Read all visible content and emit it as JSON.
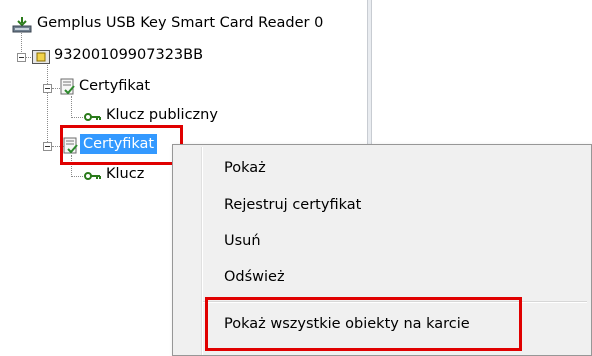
{
  "tree": {
    "reader_label": "Gemplus USB Key Smart Card Reader 0",
    "card_label": "93200109907323BB",
    "cert1_label": "Certyfikat",
    "key1_label": "Klucz publiczny",
    "cert2_label": "Certyfikat",
    "key2_label": "Klucz"
  },
  "context_menu": {
    "items": [
      "Pokaż",
      "Rejestruj certyfikat",
      "Usuń",
      "Odśwież"
    ],
    "show_all_label": "Pokaż wszystkie obiekty na karcie"
  },
  "colors": {
    "selection": "#3399ff",
    "highlight_box": "#e00000",
    "menu_background": "#f0f0f0"
  }
}
